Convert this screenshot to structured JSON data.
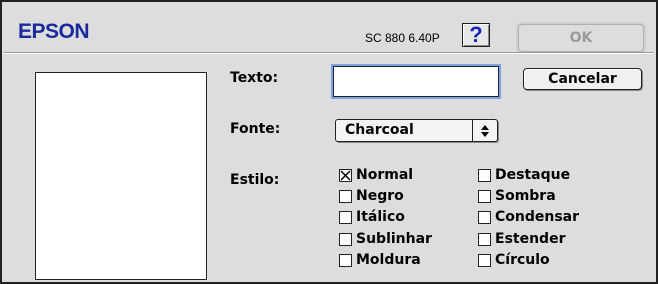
{
  "header": {
    "logo": "EPSON",
    "version": "SC 880 6.40P",
    "help_label": "?",
    "ok_label": "OK"
  },
  "form": {
    "texto_label": "Texto:",
    "texto_value": "",
    "cancel_label": "Cancelar",
    "fonte_label": "Fonte:",
    "fonte_value": "Charcoal",
    "estilo_label": "Estilo:"
  },
  "styles": {
    "normal": {
      "label": "Normal",
      "checked": true
    },
    "negro": {
      "label": "Negro",
      "checked": false
    },
    "italico": {
      "label": "Itálico",
      "checked": false
    },
    "sublinhar": {
      "label": "Sublinhar",
      "checked": false
    },
    "moldura": {
      "label": "Moldura",
      "checked": false
    },
    "destaque": {
      "label": "Destaque",
      "checked": false
    },
    "sombra": {
      "label": "Sombra",
      "checked": false
    },
    "condensar": {
      "label": "Condensar",
      "checked": false
    },
    "estender": {
      "label": "Estender",
      "checked": false
    },
    "circulo": {
      "label": "Círculo",
      "checked": false
    }
  },
  "colors": {
    "logo": "#1a2a9c",
    "help_icon": "#1626b8",
    "focus_ring": "#7aa3e0"
  }
}
